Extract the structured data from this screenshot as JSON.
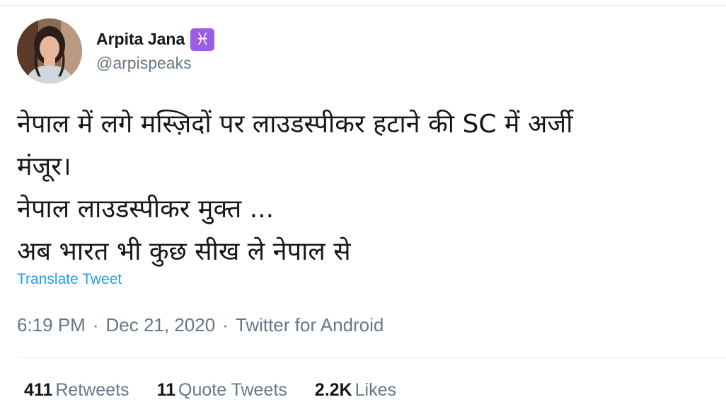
{
  "author": {
    "display_name": "Arpita Jana",
    "badge_icon": "pisces-icon",
    "badge_glyph": "♓",
    "handle": "@arpispeaks"
  },
  "tweet": {
    "lines": [
      "नेपाल में लगे मस्ज़िदों पर लाउडस्पीकर हटाने की SC में अर्जी",
      "मंजूर।",
      "नेपाल लाउडस्पीकर मुक्त ...",
      "अब भारत भी कुछ सीख ले नेपाल से"
    ],
    "translate_label": "Translate Tweet"
  },
  "meta": {
    "time": "6:19 PM",
    "separator": "·",
    "date": "Dec 21, 2020",
    "source": "Twitter for Android"
  },
  "stats": {
    "retweets_count": "411",
    "retweets_label": "Retweets",
    "quote_count": "11",
    "quote_label": "Quote Tweets",
    "likes_count": "2.2K",
    "likes_label": "Likes"
  },
  "colors": {
    "link": "#1da1f2",
    "secondary_text": "#657786",
    "badge": "#9b5de5"
  }
}
